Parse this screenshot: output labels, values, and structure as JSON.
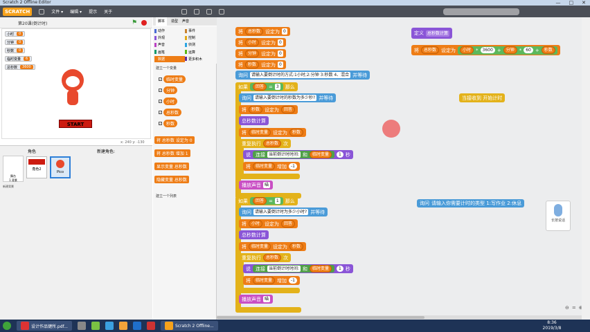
{
  "window": {
    "title": "Scratch 2 Offline Editor",
    "controls": [
      "—",
      "□",
      "✕"
    ]
  },
  "menu": {
    "logo": "SCRATCH",
    "items": [
      "文件 ▾",
      "编辑 ▾",
      "提示",
      "关于"
    ]
  },
  "stage": {
    "title": "第20课(倒计时)",
    "start_label": "START",
    "coords": "x: 240  y: -130",
    "monitors": [
      {
        "label": "小时",
        "value": "0"
      },
      {
        "label": "分钟",
        "value": "0"
      },
      {
        "label": "秒数",
        "value": "0"
      },
      {
        "label": "临时变量",
        "value": "6"
      },
      {
        "label": "总秒数",
        "value": "3600"
      }
    ]
  },
  "sprites": {
    "label": "角色",
    "new_label": "新建角色:",
    "stage_name": "舞台",
    "stage_sub": "1 背景",
    "new_bg": "新建背景",
    "items": [
      {
        "name": "角色2"
      },
      {
        "name": "Pico"
      }
    ]
  },
  "palette": {
    "tabs": [
      "脚本",
      "造型",
      "声音"
    ],
    "categories": [
      {
        "name": "动作",
        "color": "#4a6cd4"
      },
      {
        "name": "事件",
        "color": "#c88330"
      },
      {
        "name": "外观",
        "color": "#8a55d7"
      },
      {
        "name": "控制",
        "color": "#e1a91a"
      },
      {
        "name": "声音",
        "color": "#bb42c3"
      },
      {
        "name": "侦测",
        "color": "#2ca5e2"
      },
      {
        "name": "画笔",
        "color": "#0e9a6c"
      },
      {
        "name": "运算",
        "color": "#5cb712"
      },
      {
        "name": "数据",
        "color": "#ee7d16"
      },
      {
        "name": "更多积木",
        "color": "#632d99"
      }
    ],
    "make_var": "建立一个变量",
    "make_list": "建立一个列表",
    "vars": [
      "临时变量",
      "分钟",
      "小时",
      "总秒数",
      "秒数"
    ],
    "blocks": [
      "将 总秒数 设定为 0",
      "将 总秒数 增加 1",
      "显示变量 总秒数",
      "隐藏变量 总秒数"
    ]
  },
  "script": {
    "sets": [
      {
        "v": "总秒数",
        "n": "0"
      },
      {
        "v": "小时",
        "n": "0"
      },
      {
        "v": "分钟",
        "n": "0"
      },
      {
        "v": "秒数",
        "n": "0"
      }
    ],
    "ask_main": "请输入要倒计时的方式:1小时;2:分钟 3:秒数 4、混合",
    "if1": {
      "cond": "3",
      "ask": "请输入要倒计时的秒数为多少秒?",
      "set_from": "回答",
      "set_var": "秒数",
      "call": "总秒数计算",
      "tmp": "临时变量",
      "tmpval": "秒数",
      "repeat": "总秒数",
      "say_a": "当前倒计时时间:",
      "say_b": "临时变量",
      "secs": "1",
      "chg": "-1",
      "sound": "喵"
    },
    "if2": {
      "cond": "1",
      "ask": "请输入要倒计时为多少小时?",
      "set_var": "小时",
      "set_from": "回答",
      "call": "总秒数计算",
      "tmpval": "秒数",
      "repeat": "总秒数",
      "say_a": "当前倒计时时间:",
      "say_b": "临时变量",
      "secs": "1",
      "chg": "-1",
      "sound": "喵"
    },
    "words": {
      "set": "将",
      "to": "设定为",
      "ask": "询问",
      "wait": "并等待",
      "if": "如果",
      "then": "那么",
      "answer": "回答",
      "repeat": "重复执行",
      "times": "次",
      "say": "说",
      "join": "连接",
      "and": "和",
      "sec": "秒",
      "change": "增加",
      "play": "播放声音"
    },
    "define": {
      "label": "定义",
      "name": "总秒数计算",
      "expr": [
        "小时",
        "3600",
        "分钟",
        "60",
        "秒数"
      ]
    },
    "broadcast": "当接收到 开始计时",
    "ask_type": "请输入你需要计时的类型 1:写作业 2:休息"
  },
  "voice": {
    "label": "长按说话"
  },
  "taskbar": {
    "task1": "设计作品键所.pdf...",
    "task2": "Scratch 2 Offline...",
    "time": "8:36",
    "date": "2019/3/8"
  }
}
